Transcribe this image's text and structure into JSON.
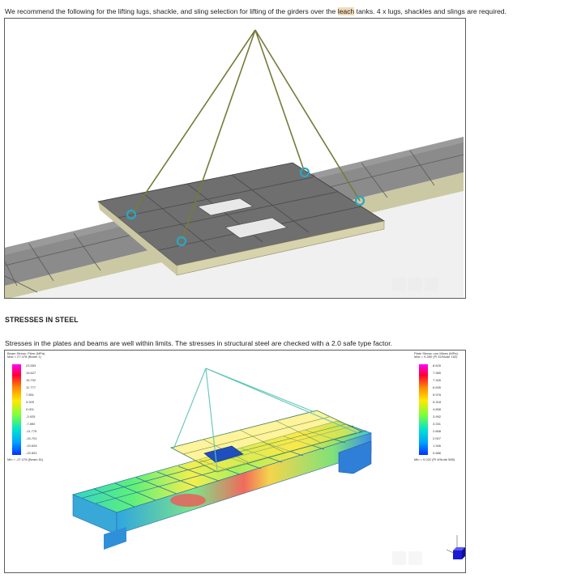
{
  "intro": {
    "before": "We recommend the following for the lifting lugs, shackle, and sling selection for lifting of the girders over the ",
    "highlight": "leach",
    "after": " tanks. 4 x lugs, shackles and slings are required."
  },
  "section": {
    "heading": "STRESSES IN STEEL",
    "paragraph": "Stresses in the plates and beams are well within limits. The stresses in structural steel are checked with a 2.0 safe type factor."
  },
  "beam_legend": {
    "title": "Beam Stress: Fibre (MPa)",
    "max": "Max = 27.478 (Beam 1)",
    "ticks": [
      "23.553",
      "19.627",
      "15.702",
      "11.777",
      "7.851",
      "3.925",
      "0.001",
      "-3.925",
      "-7.850",
      "-11.775",
      "-15.701",
      "-19.626",
      "-23.551"
    ],
    "min": "Min = -27.478 (Beam 61)"
  },
  "plate_legend": {
    "title": "Plate Stress: von Mises (MPa)",
    "max": "Max = 9.280 (Pl 32/Node 162)",
    "ticks": [
      "8.625",
      "7.985",
      "7.345",
      "6.635",
      "5.978",
      "5.318",
      "4.658",
      "3.992",
      "3.331",
      "2.668",
      "2.007",
      "1.346",
      "0.686"
    ],
    "min": "Min = 0.022 (Pl 4/Node 585)"
  },
  "colors": {
    "sling": "#7a7a3c",
    "lug": "#2aa6c4",
    "deck": "#8a8a8a",
    "deck_edge": "#c9c7a2",
    "frame_border": "#5c5c5c",
    "highlight": "#f2dcb5"
  },
  "icons": {
    "axis_triad": "axis-triad-icon",
    "nav_controls": "viewer-nav-icons"
  }
}
